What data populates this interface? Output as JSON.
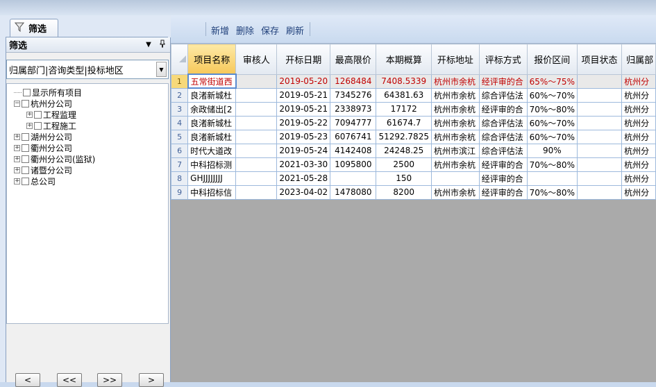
{
  "panel": {
    "tab_label": "筛选",
    "header_title": "筛选",
    "header_dropdown": "▼",
    "header_pin": "ᵖ",
    "combo_value": "归属部门|咨询类型|投标地区",
    "tree": [
      {
        "label": "显示所有项目",
        "expander": ""
      },
      {
        "label": "杭州分公司",
        "expander": "−"
      },
      {
        "label": "工程监理",
        "expander": "+"
      },
      {
        "label": "工程施工",
        "expander": "+"
      },
      {
        "label": "湖州分公司",
        "expander": "+"
      },
      {
        "label": "衢州分公司",
        "expander": "+"
      },
      {
        "label": "衢州分公司(监狱)",
        "expander": "+"
      },
      {
        "label": "诸暨分公司",
        "expander": "+"
      },
      {
        "label": "总公司",
        "expander": "+"
      }
    ],
    "nav": [
      "<",
      "<<",
      ">>",
      ">"
    ]
  },
  "toolbar": {
    "buttons": [
      "新增",
      "删除",
      "保存",
      "刷新"
    ]
  },
  "grid": {
    "columns": [
      "项目名称",
      "审核人",
      "开标日期",
      "最高限价",
      "本期概算",
      "开标地址",
      "评标方式",
      "报价区间",
      "项目状态",
      "归属部"
    ],
    "rows": [
      {
        "n": "1",
        "cells": [
          "五常街道西",
          "",
          "2019-05-20",
          "1268484",
          "7408.5339",
          "杭州市余杭",
          "经评审的合",
          "65%～75%",
          "",
          "杭州分"
        ]
      },
      {
        "n": "2",
        "cells": [
          "良渚新城杜",
          "",
          "2019-05-21",
          "7345276",
          "64381.63",
          "杭州市余杭",
          "综合评估法",
          "60%～70%",
          "",
          "杭州分"
        ]
      },
      {
        "n": "3",
        "cells": [
          "余政储出[2",
          "",
          "2019-05-21",
          "2338973",
          "17172",
          "杭州市余杭",
          "经评审的合",
          "70%～80%",
          "",
          "杭州分"
        ]
      },
      {
        "n": "4",
        "cells": [
          "良渚新城杜",
          "",
          "2019-05-22",
          "7094777",
          "61674.7",
          "杭州市余杭",
          "综合评估法",
          "60%～70%",
          "",
          "杭州分"
        ]
      },
      {
        "n": "5",
        "cells": [
          "良渚新城杜",
          "",
          "2019-05-23",
          "6076741",
          "51292.7825",
          "杭州市余杭",
          "综合评估法",
          "60%～70%",
          "",
          "杭州分"
        ]
      },
      {
        "n": "6",
        "cells": [
          "时代大道改",
          "",
          "2019-05-24",
          "4142408",
          "24248.25",
          "杭州市滨江",
          "综合评估法",
          "90%",
          "",
          "杭州分"
        ]
      },
      {
        "n": "7",
        "cells": [
          "中科招标测",
          "",
          "2021-03-30",
          "1095800",
          "2500",
          "杭州市余杭",
          "经评审的合",
          "70%～80%",
          "",
          "杭州分"
        ]
      },
      {
        "n": "8",
        "cells": [
          "GHJJJJJJJJ",
          "",
          "2021-05-28",
          "",
          "150",
          "",
          "经评审的合",
          "",
          "",
          "杭州分"
        ]
      },
      {
        "n": "9",
        "cells": [
          "中科招标信",
          "",
          "2023-04-02",
          "1478080",
          "8200",
          "杭州市余杭",
          "经评审的合",
          "70%～80%",
          "",
          "杭州分"
        ]
      }
    ]
  }
}
